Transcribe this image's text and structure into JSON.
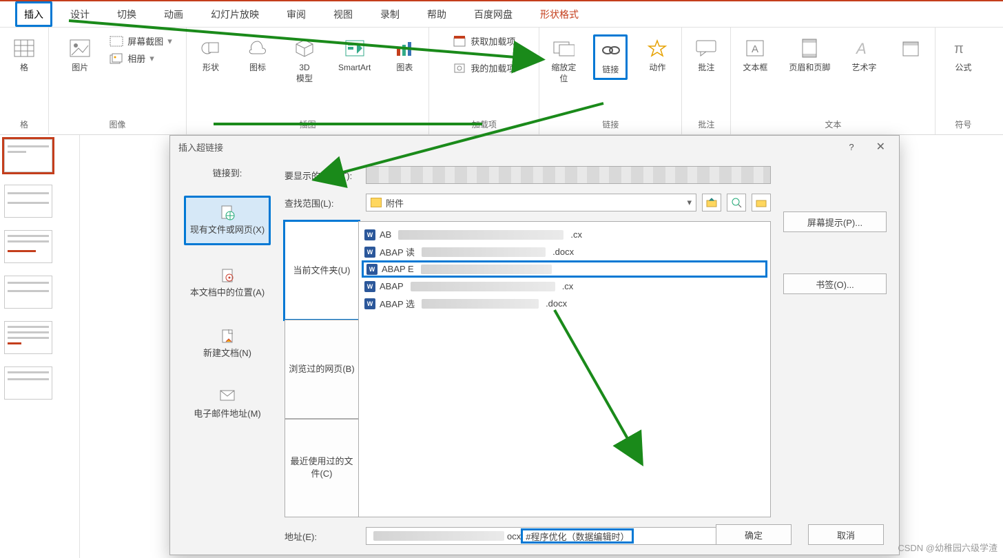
{
  "tabs": {
    "insert": "插入",
    "design": "设计",
    "transition": "切换",
    "animation": "动画",
    "slideshow": "幻灯片放映",
    "review": "审阅",
    "view": "视图",
    "record": "录制",
    "help": "帮助",
    "baidu": "百度网盘",
    "format": "形状格式"
  },
  "ribbon": {
    "table": "格",
    "image": "图片",
    "screenshot": "屏幕截图",
    "album": "相册",
    "shape": "形状",
    "icon": "图标",
    "model3d": "3D\n模型",
    "smartart": "SmartArt",
    "chart": "图表",
    "get_addins": "获取加载项",
    "my_addins": "我的加载项",
    "zoom": "缩放定\n位",
    "link": "链接",
    "action": "动作",
    "comment": "批注",
    "textbox": "文本框",
    "headerfooter": "页眉和页脚",
    "wordart": "艺术字",
    "extra": "",
    "equation": "公式",
    "symbol": "符号",
    "groups": {
      "image": "图像",
      "illus": "插图",
      "addin": "加载项",
      "link": "链接",
      "comment": "批注",
      "text": "文本",
      "symbol": "符号"
    }
  },
  "dialog": {
    "title": "插入超链接",
    "help": "?",
    "close": "✕",
    "link_to": "链接到:",
    "disp_text": "要显示的文字(T):",
    "screentip": "屏幕提示(P)...",
    "look_in": "查找范围(L):",
    "folder": "附件",
    "bookmark": "书签(O)...",
    "opts": {
      "exist": "现有文件或网页(X)",
      "place": "本文档中的位置(A)",
      "newdoc": "新建文档(N)",
      "email": "电子邮件地址(M)"
    },
    "ftabs": {
      "current": "当前文件夹(U)",
      "browsed": "浏览过的网页(B)",
      "recent": "最近使用过的文件(C)"
    },
    "files": {
      "p0": "AB",
      "p1": "ABAP 读",
      "p1s": ".docx",
      "p2": "ABAP E",
      "p3": "ABAP",
      "p4": "ABAP 选",
      "p4s": ".docx",
      "sx": ".cx"
    },
    "address_label": "地址(E):",
    "address_prefix": "ocx",
    "address_suffix": "#程序优化（数据编辑时）",
    "ok": "确定",
    "cancel": "取消"
  },
  "watermark": "CSDN @幼稚园六级学渣"
}
